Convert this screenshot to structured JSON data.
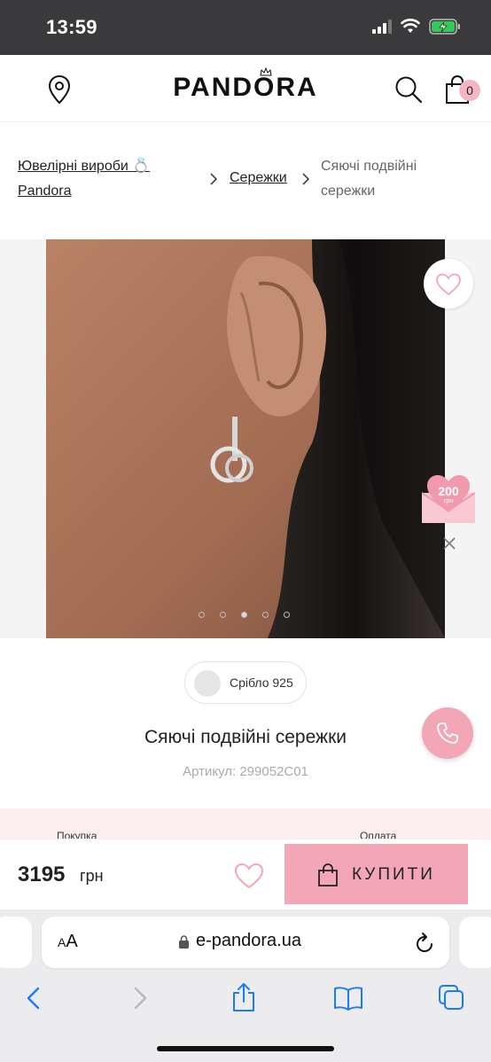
{
  "status_bar": {
    "time": "13:59"
  },
  "header": {
    "brand": "PANDORA",
    "cart_count": "0"
  },
  "breadcrumb": {
    "items": [
      "Ювелірні вироби 💍 Pandora",
      "Сережки"
    ],
    "current": "Сяючі подвійні сережки"
  },
  "gallery": {
    "promo_amount": "200",
    "promo_unit": "грн",
    "slides": 5,
    "active_slide": 3
  },
  "product": {
    "metal": "Срібло 925",
    "title": "Сяючі подвійні сережки",
    "sku": "Артикул: 299052C01"
  },
  "info_strip": {
    "left": "Покупка",
    "right": "Оплата"
  },
  "purchase": {
    "price": "3195",
    "currency": "грн",
    "buy_label": "КУПИТИ"
  },
  "browser": {
    "text_size_small": "A",
    "text_size_large": "A",
    "url": "e-pandora.ua"
  },
  "colors": {
    "accent_pink": "#f3a6b5",
    "strip_pink": "#fdeef1",
    "status_bar": "#3a3a3c"
  }
}
